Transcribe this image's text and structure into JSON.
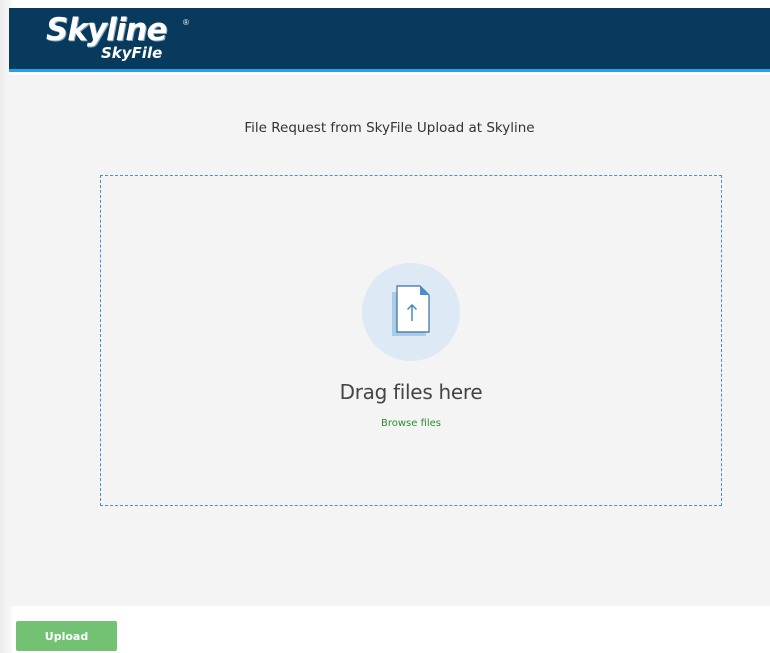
{
  "header": {
    "logo_main": "Skyline",
    "logo_sub": "SkyFile",
    "logo_mark": "®"
  },
  "request": {
    "title": "File Request from SkyFile Upload at Skyline"
  },
  "dropzone": {
    "icon": "file-upload-icon",
    "drag_text": "Drag files here",
    "browse_label": "Browse files"
  },
  "footer": {
    "upload_label": "Upload"
  },
  "colors": {
    "header_bg": "#073a5c",
    "header_accent": "#2aa0e0",
    "link_green": "#2e8b2e",
    "button_green": "#73c273"
  }
}
